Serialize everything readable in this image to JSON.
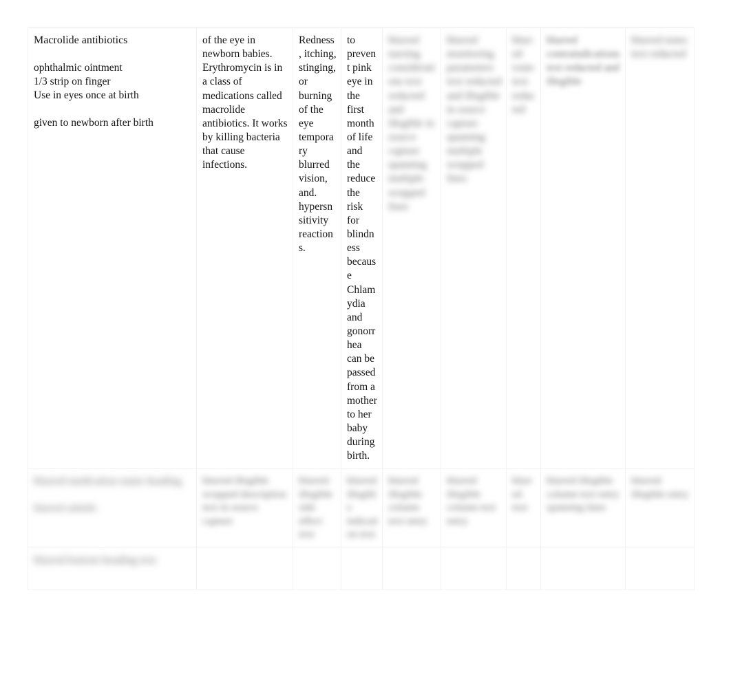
{
  "document": {
    "kind": "medication-drug-card-table",
    "background_color": "#ffffff",
    "text_color": "#141414"
  },
  "table": {
    "columns": [
      {
        "key": "drug_class",
        "legible": true
      },
      {
        "key": "action",
        "legible": true
      },
      {
        "key": "side_effects",
        "legible": true
      },
      {
        "key": "indication",
        "legible": true
      },
      {
        "key": "col5",
        "legible": false
      },
      {
        "key": "col6",
        "legible": false
      },
      {
        "key": "col7",
        "legible": false
      },
      {
        "key": "col8",
        "legible": false
      },
      {
        "key": "col9",
        "legible": false
      }
    ],
    "rows": [
      {
        "id": "row-erythromycin",
        "drug_class": {
          "line1": "Macrolide antibiotics",
          "line2": "ophthalmic ointment",
          "line3": "1/3 strip on finger",
          "line4": "Use in eyes once at birth",
          "line5": "given to newborn after birth"
        },
        "action": "of the eye in newborn babies. Erythromycin is in a class of medications called macrolide antibiotics. It works by killing bacteria that cause infections.",
        "side_effects": "Redness, itching, stinging, or burning of the eye temporary blurred vision, and. hypersnsitivity reactions.",
        "indication": "to prevent pink eye in the first month of life and the reduce the risk for blindness because Chlamydia and gonorrhea can be passed from a mother to her baby during birth.",
        "col5": "blurred nursing considerations text redacted and illegible in source capture spanning multiple wrapped lines",
        "col6": "blurred monitoring parameters text redacted and illegible in source capture spanning multiple wrapped lines",
        "col7": "blurred route text redacted",
        "col8": "blurred contraindications text redacted and illegible",
        "col9": "blurred notes text redacted"
      },
      {
        "id": "row-second",
        "drug_class": {
          "line1": "blurred medication name heading",
          "line2": "",
          "line3": "blurred subtitle",
          "line4": "",
          "line5": ""
        },
        "action": "blurred illegible wrapped description text in source capture",
        "side_effects": "blurred illegible side effect text",
        "indication": "blurred illegible indication text",
        "col5": "blurred illegible column text entry",
        "col6": "blurred illegible column text entry",
        "col7": "blurred text",
        "col8": "blurred illegible column text entry spanning lines",
        "col9": "blurred illegible entry"
      },
      {
        "id": "row-third",
        "drug_class": {
          "line1": "blurred bottom heading text",
          "line2": "",
          "line3": "",
          "line4": "",
          "line5": ""
        },
        "action": "",
        "side_effects": "",
        "indication": "",
        "col5": "",
        "col6": "",
        "col7": "",
        "col8": "",
        "col9": ""
      }
    ]
  }
}
